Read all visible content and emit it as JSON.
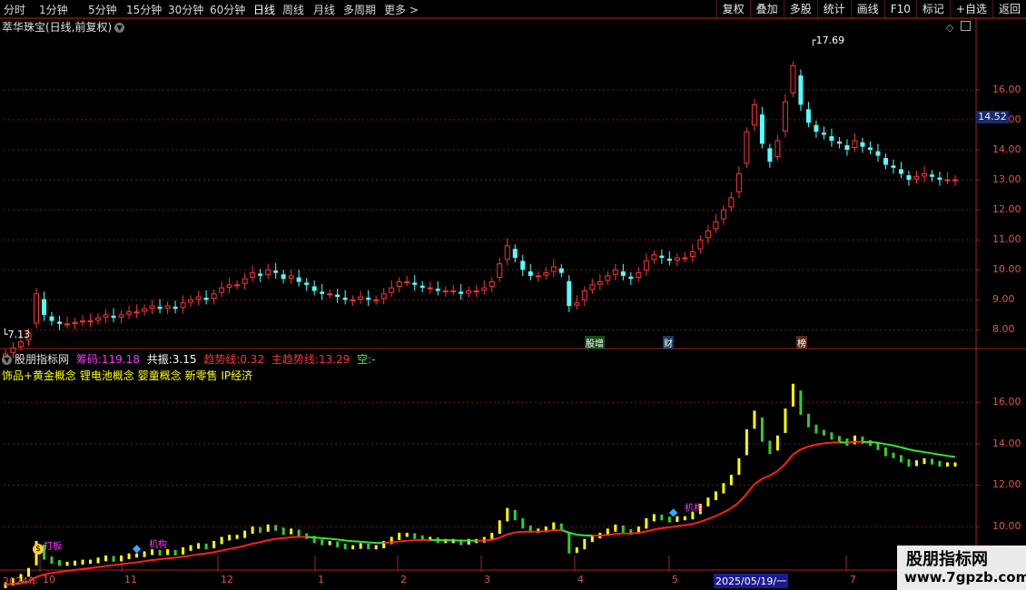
{
  "toolbar": {
    "periods": [
      "分时",
      "1分钟",
      "5分钟",
      "15分钟",
      "30分钟",
      "60分钟",
      "日线",
      "周线",
      "月线",
      "多周期",
      "更多"
    ],
    "active_period": "日线",
    "buttons": [
      "复权",
      "叠加",
      "多股",
      "统计",
      "画线",
      "F10",
      "标记",
      "+自选",
      "返回"
    ]
  },
  "stock": {
    "title": "萃华珠宝(日线,前复权)"
  },
  "indicator": {
    "name": "股朋指标网",
    "items": [
      {
        "label": "筹码:",
        "value": "119.18",
        "color": "#ff33ff"
      },
      {
        "label": "共振:",
        "value": "3.15",
        "color": "#ffffff"
      },
      {
        "label": "趋势线:",
        "value": "0.32",
        "color": "#ff3333"
      },
      {
        "label": "主趋势线:",
        "value": "13.29",
        "color": "#ff3333"
      },
      {
        "label": "空:",
        "value": "-",
        "color": "#33ff33"
      }
    ],
    "concepts": "饰品+黄金概念 锂电池概念 婴童概念 新零售 IP经济"
  },
  "colors": {
    "up": "#ff3333",
    "down": "#54ffff",
    "grid": "#7a1515",
    "axis": "#aa2020",
    "trend_up": "#ff1f1f",
    "trend_down": "#33e633",
    "bar_yellow": "#ffff00",
    "bar_green": "#33cc33"
  },
  "price_axis": {
    "labels": [
      "16.00",
      "15.00",
      "14.00",
      "13.00",
      "12.00",
      "11.00",
      "10.00",
      "9.00",
      "8.00"
    ],
    "current": "14.52"
  },
  "ind_axis": {
    "labels": [
      "16.00",
      "14.00",
      "12.00",
      "10.00"
    ]
  },
  "annotations": {
    "high": "17.69",
    "low": "7.13",
    "tag1": "股增",
    "tag2": "财",
    "tag3": "榜",
    "sig1": "打板",
    "sig2": "机构",
    "sig3": "机构"
  },
  "dates": [
    "2024年",
    "10",
    "11",
    "12",
    "1",
    "2",
    "3",
    "4",
    "5",
    "2025/05/19/一",
    "7"
  ],
  "watermark": {
    "line1": "股朋指标网",
    "line2": "www.7gpzb.com"
  },
  "chart_data": {
    "type": "candlestick",
    "title": "萃华珠宝(日线,前复权)",
    "ylim": [
      7.5,
      17.9
    ],
    "closes": [
      7.2,
      7.4,
      7.6,
      7.9,
      9.2,
      8.5,
      8.3,
      8.2,
      8.2,
      8.25,
      8.3,
      8.3,
      8.4,
      8.5,
      8.4,
      8.5,
      8.6,
      8.6,
      8.7,
      8.8,
      8.7,
      8.8,
      8.7,
      8.9,
      9.0,
      9.1,
      9.0,
      9.2,
      9.4,
      9.5,
      9.5,
      9.7,
      9.9,
      9.8,
      10.0,
      9.9,
      9.7,
      9.8,
      9.6,
      9.5,
      9.3,
      9.2,
      9.2,
      9.1,
      9.0,
      9.0,
      9.1,
      9.0,
      9.0,
      9.2,
      9.4,
      9.6,
      9.6,
      9.5,
      9.4,
      9.4,
      9.3,
      9.3,
      9.3,
      9.2,
      9.3,
      9.3,
      9.4,
      9.6,
      10.2,
      10.8,
      10.4,
      10.0,
      9.8,
      9.8,
      9.9,
      10.1,
      9.9,
      8.8,
      8.9,
      9.3,
      9.5,
      9.6,
      9.8,
      10.0,
      9.8,
      9.7,
      9.9,
      10.3,
      10.5,
      10.4,
      10.3,
      10.4,
      10.4,
      10.6,
      11.0,
      11.3,
      11.6,
      12.0,
      12.4,
      13.2,
      14.6,
      15.5,
      14.2,
      13.6,
      14.3,
      15.6,
      16.8,
      15.5,
      14.9,
      14.6,
      14.5,
      14.3,
      14.2,
      14.0,
      14.3,
      14.1,
      14.0,
      13.8,
      13.5,
      13.4,
      13.2,
      13.0,
      13.1,
      13.2,
      13.1,
      13.0,
      13.0,
      13.0
    ]
  }
}
